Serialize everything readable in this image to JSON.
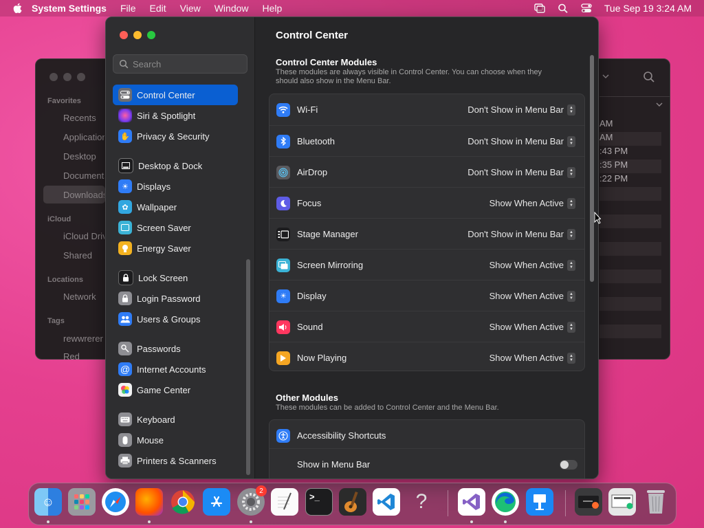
{
  "menubar": {
    "app_name": "System Settings",
    "items": [
      "File",
      "Edit",
      "View",
      "Window",
      "Help"
    ],
    "clock": "Tue Sep 19  3:24 AM"
  },
  "finder": {
    "favorites_heading": "Favorites",
    "favorites": [
      "Recents",
      "Applications",
      "Desktop",
      "Documents",
      "Downloads"
    ],
    "icloud_heading": "iCloud",
    "icloud": [
      "iCloud Drive",
      "Shared"
    ],
    "locations_heading": "Locations",
    "locations": [
      "Network"
    ],
    "tags_heading": "Tags",
    "tags": [
      "rewwrerer",
      "Red"
    ],
    "times": [
      "AM",
      " AM",
      ":43 PM",
      ":35 PM",
      ":22 PM"
    ]
  },
  "sidebar": {
    "search_placeholder": "Search",
    "items": [
      {
        "label": "Control Center",
        "icon": "control-center-icon",
        "color": "#6e6e73"
      },
      {
        "label": "Siri & Spotlight",
        "icon": "siri-icon",
        "color": "#b14cd8"
      },
      {
        "label": "Privacy & Security",
        "icon": "hand-icon",
        "color": "#2f7cf6"
      },
      {
        "label": "Desktop & Dock",
        "icon": "dock-icon",
        "color": "#1c1c1e"
      },
      {
        "label": "Displays",
        "icon": "sun-icon",
        "color": "#2f7cf6"
      },
      {
        "label": "Wallpaper",
        "icon": "flower-icon",
        "color": "#32a7e0"
      },
      {
        "label": "Screen Saver",
        "icon": "screen-saver-icon",
        "color": "#3bb3d6"
      },
      {
        "label": "Energy Saver",
        "icon": "bulb-icon",
        "color": "#f3b220"
      },
      {
        "label": "Lock Screen",
        "icon": "lock-icon",
        "color": "#1c1c1e"
      },
      {
        "label": "Login Password",
        "icon": "padlock-icon",
        "color": "#8e8e93"
      },
      {
        "label": "Users & Groups",
        "icon": "users-icon",
        "color": "#2f7cf6"
      },
      {
        "label": "Passwords",
        "icon": "key-icon",
        "color": "#8e8e93"
      },
      {
        "label": "Internet Accounts",
        "icon": "at-icon",
        "color": "#2f7cf6"
      },
      {
        "label": "Game Center",
        "icon": "game-center-icon",
        "color": "#f2f2f2"
      },
      {
        "label": "Keyboard",
        "icon": "keyboard-icon",
        "color": "#8e8e93"
      },
      {
        "label": "Mouse",
        "icon": "mouse-icon",
        "color": "#8e8e93"
      },
      {
        "label": "Printers & Scanners",
        "icon": "printer-icon",
        "color": "#8e8e93"
      }
    ]
  },
  "main": {
    "title": "Control Center",
    "modules_title": "Control Center Modules",
    "modules_subtitle": "These modules are always visible in Control Center. You can choose when they should also show in the Menu Bar.",
    "modules": [
      {
        "label": "Wi-Fi",
        "value": "Don't Show in Menu Bar",
        "icon": "wifi-icon",
        "color": "#2f7cf6"
      },
      {
        "label": "Bluetooth",
        "value": "Don't Show in Menu Bar",
        "icon": "bluetooth-icon",
        "color": "#2f7cf6"
      },
      {
        "label": "AirDrop",
        "value": "Don't Show in Menu Bar",
        "icon": "airdrop-icon",
        "color": "#5a5a5e"
      },
      {
        "label": "Focus",
        "value": "Show When Active",
        "icon": "moon-icon",
        "color": "#5e5ce6"
      },
      {
        "label": "Stage Manager",
        "value": "Don't Show in Menu Bar",
        "icon": "stage-manager-icon",
        "color": "#1c1c1e"
      },
      {
        "label": "Screen Mirroring",
        "value": "Show When Active",
        "icon": "screen-mirroring-icon",
        "color": "#3bb3d6"
      },
      {
        "label": "Display",
        "value": "Show When Active",
        "icon": "sun-icon",
        "color": "#2f7cf6"
      },
      {
        "label": "Sound",
        "value": "Show When Active",
        "icon": "speaker-icon",
        "color": "#ff375f"
      },
      {
        "label": "Now Playing",
        "value": "Show When Active",
        "icon": "play-icon",
        "color": "#f5a623"
      }
    ],
    "other_title": "Other Modules",
    "other_subtitle": "These modules can be added to Control Center and the Menu Bar.",
    "accessibility_label": "Accessibility Shortcuts",
    "show_in_menu_bar_label": "Show in Menu Bar",
    "show_in_menu_bar_on": false
  },
  "dock": {
    "apps": [
      "finder-icon",
      "launchpad-icon",
      "safari-icon",
      "firefox-icon",
      "chrome-icon",
      "app-store-icon",
      "system-settings-icon",
      "textedit-icon",
      "terminal-icon",
      "garageband-icon",
      "vscode-icon",
      "help-icon",
      "visual-studio-icon",
      "edge-icon",
      "keynote-icon",
      "downloads-stack-icon",
      "documents-stack-icon",
      "trash-icon"
    ],
    "settings_badge": "2"
  },
  "colors": {
    "accent": "#0a5fd2",
    "wallpaper": "#e8489a"
  }
}
